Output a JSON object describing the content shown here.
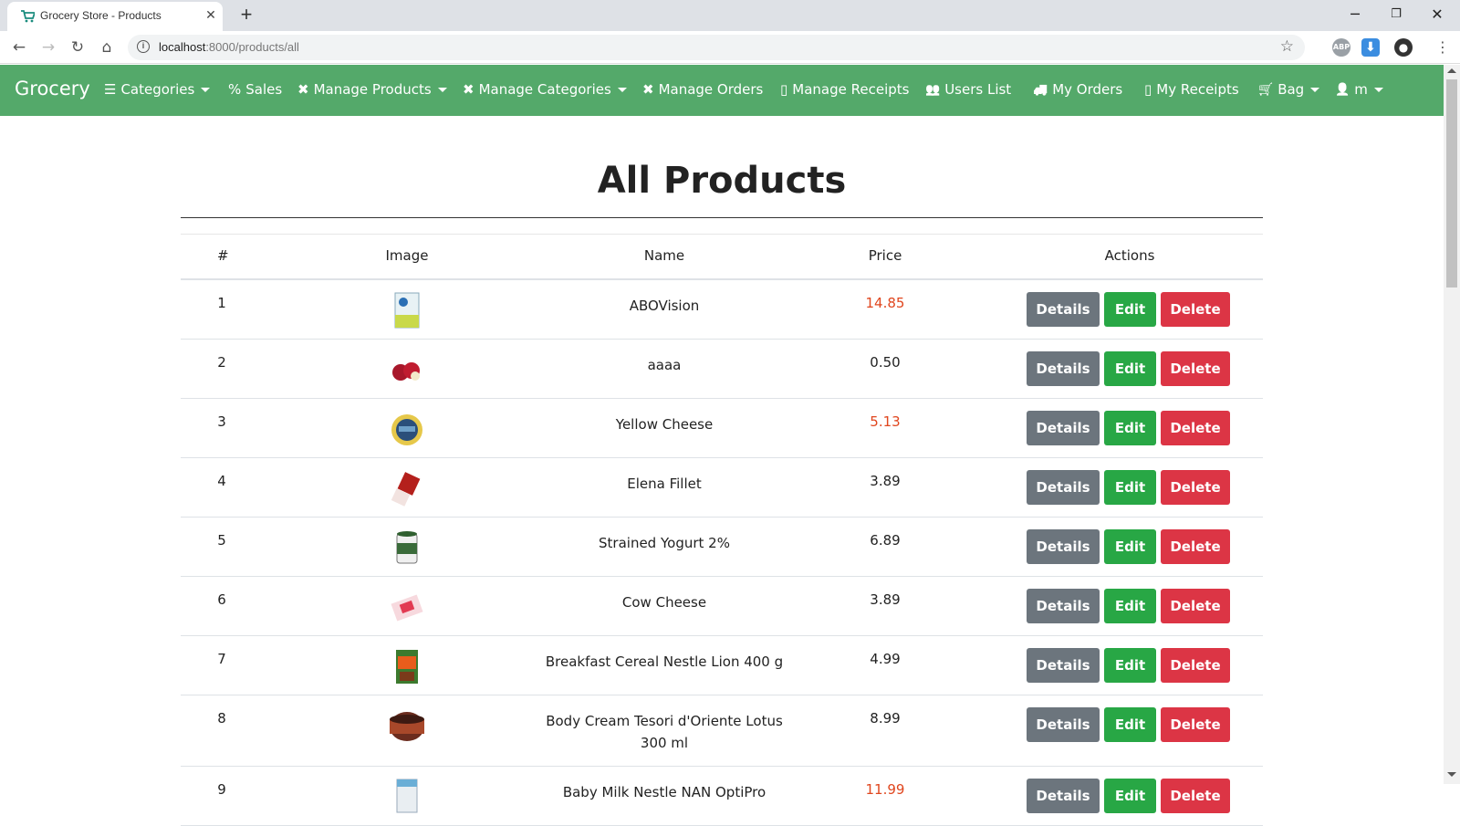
{
  "browser": {
    "tab_title": "Grocery Store - Products",
    "url_host": "localhost",
    "url_rest": ":8000/products/all",
    "ext_abp": "ABP"
  },
  "navbar": {
    "brand": "Grocery",
    "items": [
      {
        "label": "Categories",
        "icon": "list-icon",
        "dropdown": true
      },
      {
        "label": "Sales",
        "icon": "percent-icon",
        "dropdown": false
      },
      {
        "label": "Manage Products",
        "icon": "tools-icon",
        "dropdown": true
      },
      {
        "label": "Manage Categories",
        "icon": "tools-icon",
        "dropdown": true
      },
      {
        "label": "Manage Orders",
        "icon": "tools-icon",
        "dropdown": false
      },
      {
        "label": "Manage Receipts",
        "icon": "file-icon",
        "dropdown": false
      },
      {
        "label": "Users List",
        "icon": "users-icon",
        "dropdown": false
      },
      {
        "label": "My Orders",
        "icon": "truck-icon",
        "dropdown": false
      },
      {
        "label": "My Receipts",
        "icon": "file-icon",
        "dropdown": false
      },
      {
        "label": "Bag",
        "icon": "cart-icon",
        "dropdown": true
      },
      {
        "label": "m",
        "icon": "user-icon",
        "dropdown": true
      }
    ]
  },
  "page": {
    "title": "All Products"
  },
  "table": {
    "headers": {
      "num": "#",
      "image": "Image",
      "name": "Name",
      "price": "Price",
      "actions": "Actions"
    },
    "buttons": {
      "details": "Details",
      "edit": "Edit",
      "delete": "Delete"
    },
    "rows": [
      {
        "num": "1",
        "name": "ABOVision",
        "price": "14.85",
        "sale": true
      },
      {
        "num": "2",
        "name": "aaaa",
        "price": "0.50",
        "sale": false
      },
      {
        "num": "3",
        "name": "Yellow Cheese",
        "price": "5.13",
        "sale": true
      },
      {
        "num": "4",
        "name": "Elena Fillet",
        "price": "3.89",
        "sale": false
      },
      {
        "num": "5",
        "name": "Strained Yogurt 2%",
        "price": "6.89",
        "sale": false
      },
      {
        "num": "6",
        "name": "Cow Cheese",
        "price": "3.89",
        "sale": false
      },
      {
        "num": "7",
        "name": "Breakfast Cereal Nestle Lion 400 g",
        "price": "4.99",
        "sale": false
      },
      {
        "num": "8",
        "name": "Body Cream Tesori d'Oriente Lotus 300 ml",
        "price": "8.99",
        "sale": false
      },
      {
        "num": "9",
        "name": "Baby Milk Nestle NAN OptiPro",
        "price": "11.99",
        "sale": true
      }
    ]
  },
  "colors": {
    "navbar": "#54a96a",
    "sale_price": "#e0461e",
    "details": "#6c757d",
    "edit": "#28a745",
    "delete": "#dc3545"
  }
}
